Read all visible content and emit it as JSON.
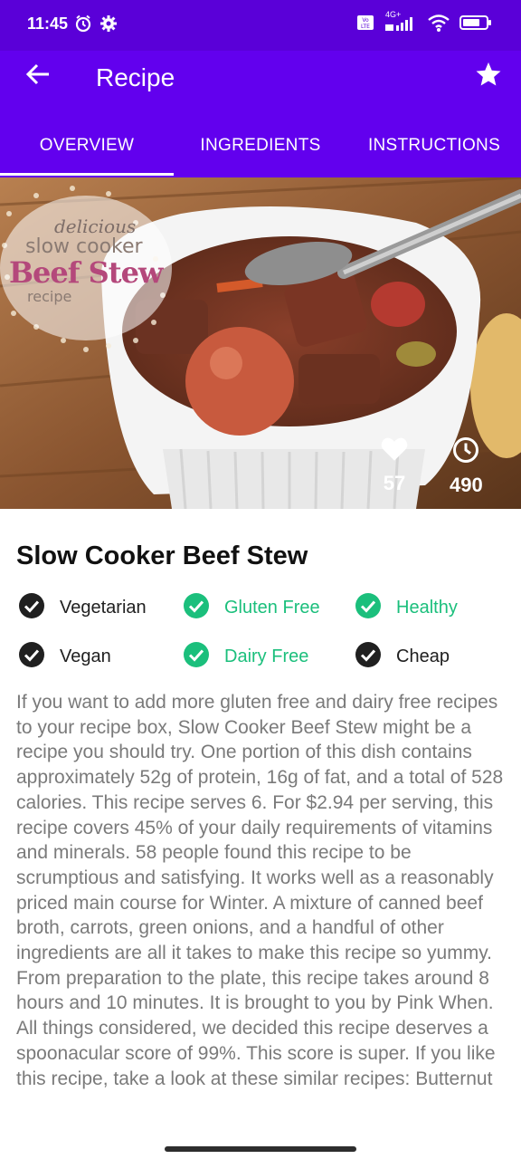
{
  "status_bar": {
    "time": "11:45",
    "network": "4G+",
    "volte": "Vo LTE"
  },
  "app_bar": {
    "title": "Recipe"
  },
  "tabs": [
    {
      "label": "OVERVIEW",
      "active": true
    },
    {
      "label": "INGREDIENTS",
      "active": false
    },
    {
      "label": "INSTRUCTIONS",
      "active": false
    }
  ],
  "hero": {
    "image_text": {
      "line1": "delicious",
      "line2": "slow cooker",
      "line3": "Beef Stew",
      "line4": "recipe"
    },
    "likes": "57",
    "minutes": "490"
  },
  "recipe": {
    "title": "Slow Cooker Beef Stew",
    "tags": [
      {
        "label": "Vegetarian",
        "active": false
      },
      {
        "label": "Gluten Free",
        "active": true
      },
      {
        "label": "Healthy",
        "active": true
      },
      {
        "label": "Vegan",
        "active": false
      },
      {
        "label": "Dairy Free",
        "active": true
      },
      {
        "label": "Cheap",
        "active": false
      }
    ],
    "description": "If you want to add more gluten free and dairy free recipes to your recipe box, Slow Cooker Beef Stew might be a recipe you should try. One portion of this dish contains approximately 52g of protein, 16g of fat, and a total of 528 calories. This recipe serves 6. For $2.94 per serving, this recipe covers 45% of your daily requirements of vitamins and minerals. 58 people found this recipe to be scrumptious and satisfying. It works well as a reasonably priced main course for Winter. A mixture of canned beef broth, carrots, green onions, and a handful of other ingredients are all it takes to make this recipe so yummy. From preparation to the plate, this recipe takes around 8 hours and 10 minutes. It is brought to you by Pink When. All things considered, we decided this recipe deserves a spoonacular score of 99%. This score is super. If you like this recipe, take a look at these similar recipes: Butternut"
  },
  "colors": {
    "primary": "#6200ee",
    "status_bar": "#5a00d8",
    "tag_active": "#1bbf7c",
    "tag_inactive": "#202020",
    "description_text": "#7a7a7a"
  },
  "icons": [
    "back-arrow-icon",
    "star-icon",
    "heart-icon",
    "clock-icon",
    "check-circle-icon"
  ]
}
